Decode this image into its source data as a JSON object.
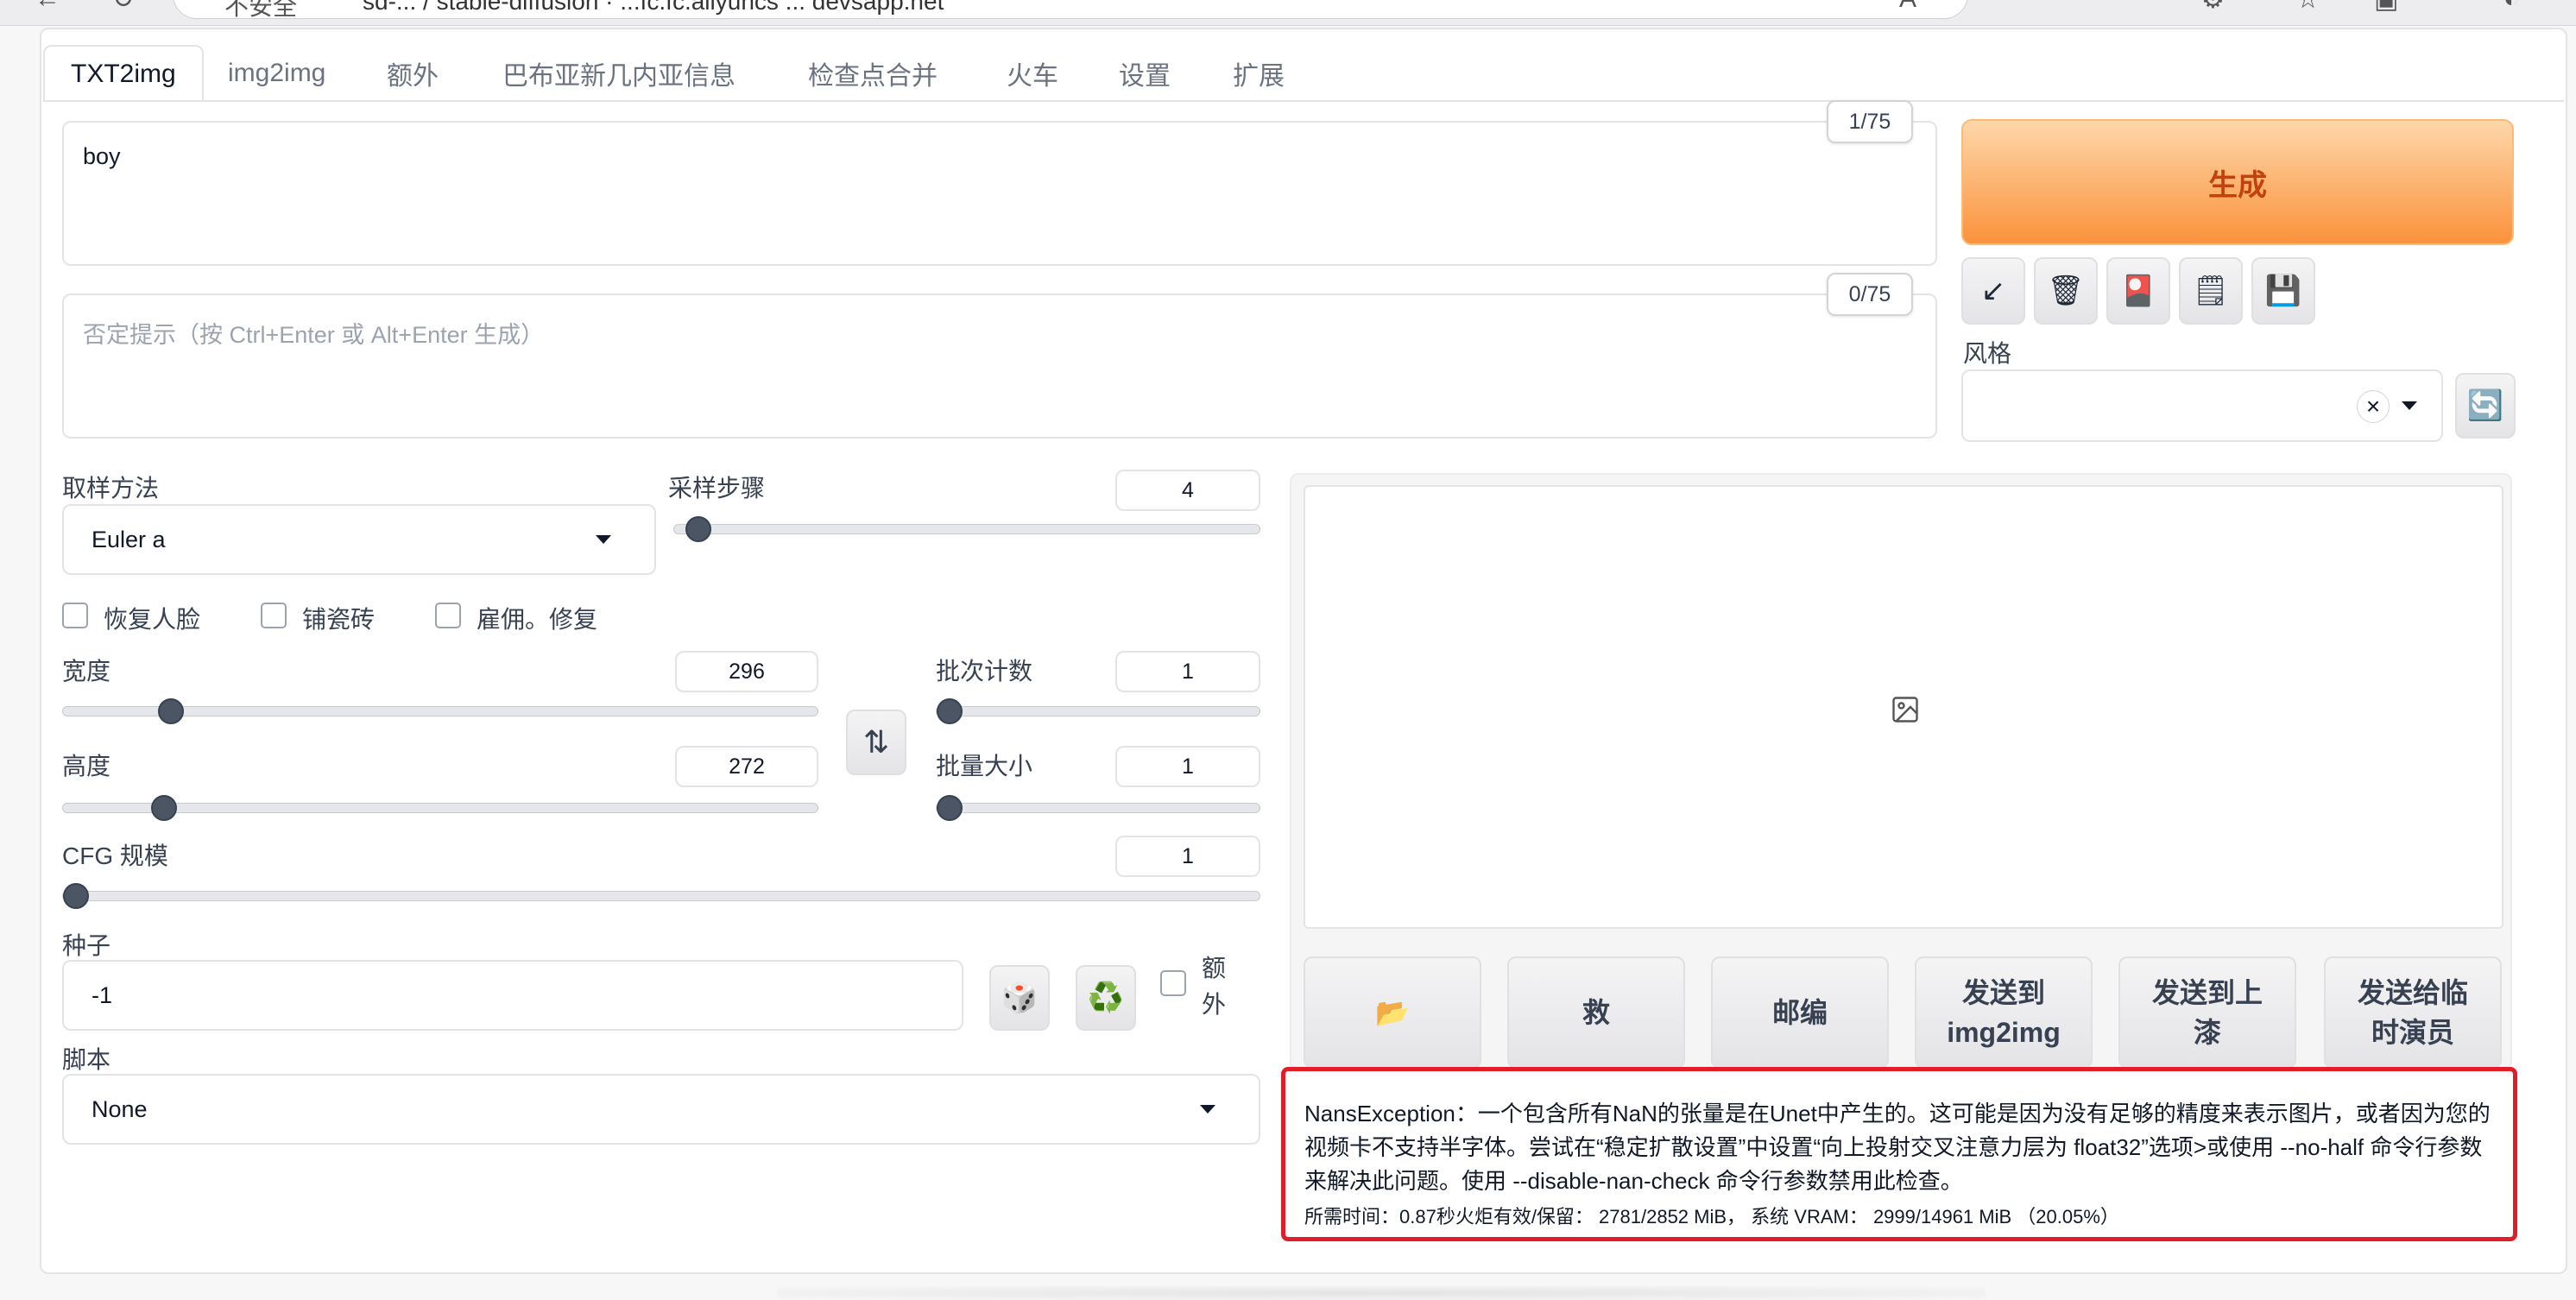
{
  "browser": {
    "security_label": "不安全",
    "url": "sd-... / stable-diffusion  ·  ...fc.fc.aliyuncs ... devsapp.net"
  },
  "tabs": [
    {
      "label": "TXT2img",
      "active": true
    },
    {
      "label": "img2img",
      "active": false
    },
    {
      "label": "额外",
      "active": false
    },
    {
      "label": "巴布亚新几内亚信息",
      "active": false
    },
    {
      "label": "检查点合并",
      "active": false
    },
    {
      "label": "火车",
      "active": false
    },
    {
      "label": "设置",
      "active": false
    },
    {
      "label": "扩展",
      "active": false
    }
  ],
  "prompt": {
    "value": "boy",
    "token_count": "1/75"
  },
  "negative_prompt": {
    "placeholder": "否定提示（按 Ctrl+Enter 或 Alt+Enter 生成）",
    "token_count": "0/75"
  },
  "generate": {
    "label": "生成"
  },
  "tool_buttons": [
    {
      "icon": "arrow-down-left-icon",
      "glyph": "↙"
    },
    {
      "icon": "trash-icon",
      "glyph": "🗑"
    },
    {
      "icon": "red-card-icon",
      "glyph": "🎴"
    },
    {
      "icon": "notepad-icon",
      "glyph": "🗒"
    },
    {
      "icon": "save-icon",
      "glyph": "💾"
    }
  ],
  "style": {
    "label": "风格",
    "clear_glyph": "×",
    "refresh_glyph": "🔄"
  },
  "sampling": {
    "method_label": "取样方法",
    "method_value": "Euler a",
    "steps_label": "采样步骤",
    "steps_value": "4",
    "steps_fraction": 0.02
  },
  "options": [
    {
      "label": "恢复人脸",
      "checked": false
    },
    {
      "label": "铺瓷砖",
      "checked": false
    },
    {
      "label": "雇佣。修复",
      "checked": false
    }
  ],
  "width": {
    "label": "宽度",
    "value": "296",
    "fraction": 0.13
  },
  "height": {
    "label": "高度",
    "value": "272",
    "fraction": 0.12
  },
  "swap_glyph": "⇅",
  "batch_count": {
    "label": "批次计数",
    "value": "1",
    "fraction": 0.0
  },
  "batch_size": {
    "label": "批量大小",
    "value": "1",
    "fraction": 0.0
  },
  "cfg": {
    "label": "CFG 规模",
    "value": "1",
    "fraction": 0.0
  },
  "seed": {
    "label": "种子",
    "value": "-1",
    "dice_glyph": "🎲",
    "recycle_glyph": "♻️",
    "extra_label_1": "额",
    "extra_label_2": "外"
  },
  "script": {
    "label": "脚本",
    "value": "None"
  },
  "output_buttons": [
    {
      "line1": "📂",
      "line2": ""
    },
    {
      "line1": "救",
      "line2": ""
    },
    {
      "line1": "邮编",
      "line2": ""
    },
    {
      "line1": "发送到",
      "line2": "img2img"
    },
    {
      "line1": "发送到上",
      "line2": "漆"
    },
    {
      "line1": "发送给临",
      "line2": "时演员"
    }
  ],
  "error": {
    "message": "NansException：一个包含所有NaN的张量是在Unet中产生的。这可能是因为没有足够的精度来表示图片，或者因为您的视频卡不支持半字体。尝试在“稳定扩散设置”中设置“向上投射交叉注意力层为 float32”选项>或使用 --no-half 命令行参数来解决此问题。使用 --disable-nan-check 命令行参数禁用此检查。",
    "timing": "所需时间：0.87秒火炬有效/保留： 2781/2852 MiB， 系统 VRAM： 2999/14961 MiB （20.05%）",
    "border_color": "#e11d2a"
  },
  "colors": {
    "accent_orange": "#fb923c",
    "generate_text": "#c2410c",
    "slider_thumb": "#4b5563"
  }
}
